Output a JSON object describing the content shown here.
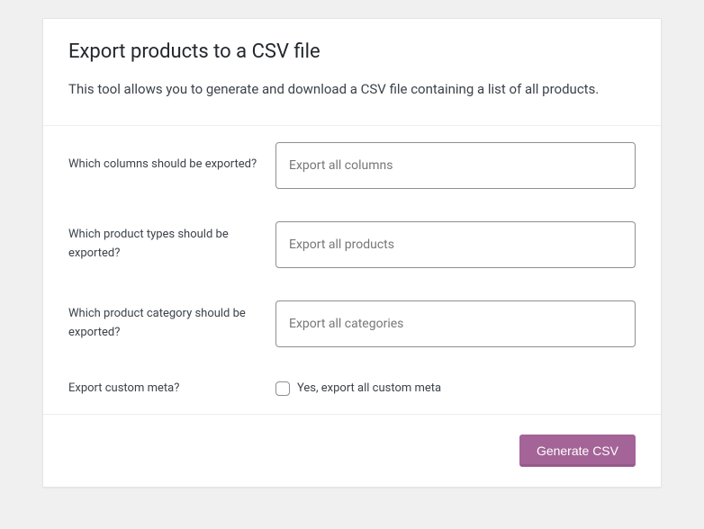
{
  "header": {
    "title": "Export products to a CSV file",
    "subtitle": "This tool allows you to generate and download a CSV file containing a list of all products."
  },
  "form": {
    "columns": {
      "label": "Which columns should be exported?",
      "placeholder": "Export all columns"
    },
    "product_types": {
      "label": "Which product types should be exported?",
      "placeholder": "Export all products"
    },
    "product_category": {
      "label": "Which product category should be exported?",
      "placeholder": "Export all categories"
    },
    "custom_meta": {
      "label": "Export custom meta?",
      "checkbox_label": "Yes, export all custom meta"
    }
  },
  "footer": {
    "submit_label": "Generate CSV"
  }
}
